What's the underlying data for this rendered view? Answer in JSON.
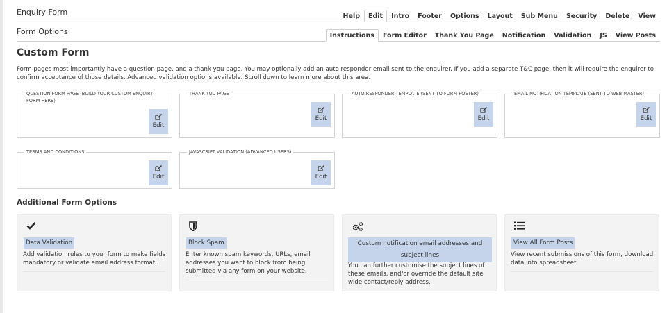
{
  "header": {
    "title": "Enquiry Form",
    "tabs": [
      "Help",
      "Edit",
      "Intro",
      "Footer",
      "Options",
      "Layout",
      "Sub Menu",
      "Security",
      "Delete",
      "View"
    ],
    "active_tab": "Edit"
  },
  "subheader": {
    "title": "Form Options",
    "tabs": [
      "Instructions",
      "Form Editor",
      "Thank You Page",
      "Notification",
      "Validation",
      "JS",
      "View Posts"
    ],
    "active_tab": "Instructions"
  },
  "main": {
    "title": "Custom Form",
    "intro": "Form pages most importantly have a question page, and a thank you page. You may optionally add an auto responder email sent to the enquirer. If you add a separate T&C page, then it will require the enquirer to confirm acceptance of those details. Advanced validation options available. Scroll down to learn more about this area.",
    "templates": [
      {
        "legend": "Question form page (build your custom enquiry form here)",
        "button": "Edit"
      },
      {
        "legend": "Thank you page",
        "button": "Edit"
      },
      {
        "legend": "Auto responder template (sent to form poster)",
        "button": "Edit"
      },
      {
        "legend": "Email notification template (sent to web master)",
        "button": "Edit"
      },
      {
        "legend": "Terms and conditions",
        "button": "Edit"
      },
      {
        "legend": "Javascript validation (advanced users)",
        "button": "Edit"
      }
    ],
    "additional_title": "Additional Form Options",
    "options": [
      {
        "icon": "check-icon",
        "label": "Data Validation",
        "desc": "Add validation rules to your form to make fields mandatory or validate email address format."
      },
      {
        "icon": "shield-icon",
        "label": "Block Spam",
        "desc": "Enter known spam keywords, URLs, email addresses you want to block from being submitted via any form on your website."
      },
      {
        "icon": "gears-icon",
        "label": "Custom notification email addresses and subject lines",
        "desc": "You can further customise the subject lines of these emails, and/or override the default site wide contact/reply address."
      },
      {
        "icon": "list-icon",
        "label": "View All Form Posts",
        "desc": "View recent submissions of this form, download data into spreadsheet."
      }
    ]
  }
}
